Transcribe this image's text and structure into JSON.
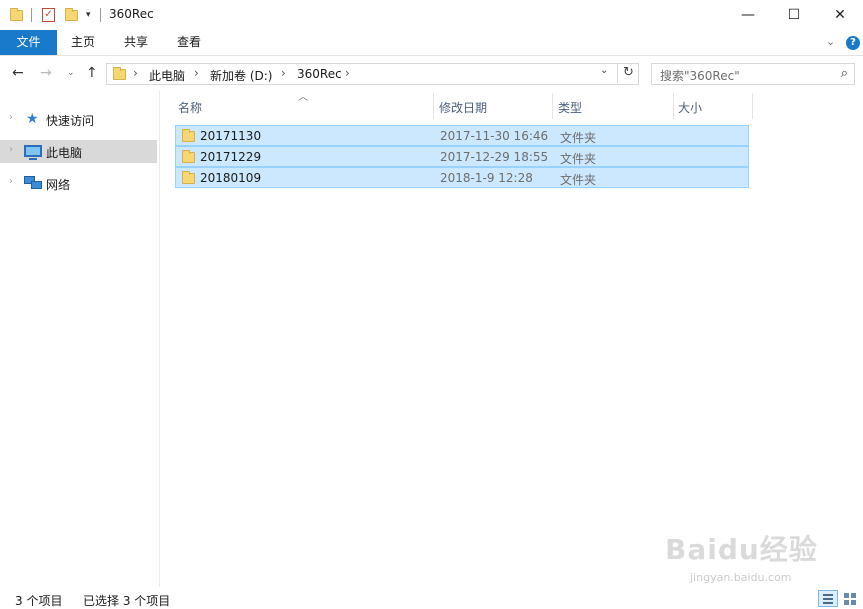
{
  "window": {
    "title": "360Rec",
    "minimize_glyph": "—",
    "maximize_glyph": "☐",
    "close_glyph": "✕"
  },
  "ribbon": {
    "tabs": [
      "文件",
      "主页",
      "共享",
      "查看"
    ],
    "help_glyph": "?"
  },
  "address": {
    "segments": [
      "此电脑",
      "新加卷 (D:)",
      "360Rec"
    ],
    "search_placeholder": "搜索\"360Rec\""
  },
  "nav_pane": {
    "items": [
      {
        "label": "快速访问",
        "icon": "star-icon",
        "selected": false
      },
      {
        "label": "此电脑",
        "icon": "computer-icon",
        "selected": true
      },
      {
        "label": "网络",
        "icon": "network-icon",
        "selected": false
      }
    ]
  },
  "columns": {
    "name": "名称",
    "modified": "修改日期",
    "type": "类型",
    "size": "大小"
  },
  "files": [
    {
      "name": "20171130",
      "modified": "2017-11-30 16:46",
      "type": "文件夹",
      "size": ""
    },
    {
      "name": "20171229",
      "modified": "2017-12-29 18:55",
      "type": "文件夹",
      "size": ""
    },
    {
      "name": "20180109",
      "modified": "2018-1-9 12:28",
      "type": "文件夹",
      "size": ""
    }
  ],
  "status": {
    "item_count": "3 个项目",
    "selected_count": "已选择 3 个项目"
  },
  "watermark": {
    "logo_text": "Baidu经验",
    "url_text": "jingyan.baidu.com"
  },
  "colors": {
    "accent": "#1979ca",
    "selection_bg": "#cce8ff",
    "selection_border": "#99d1ff",
    "folder": "#f7d774"
  }
}
